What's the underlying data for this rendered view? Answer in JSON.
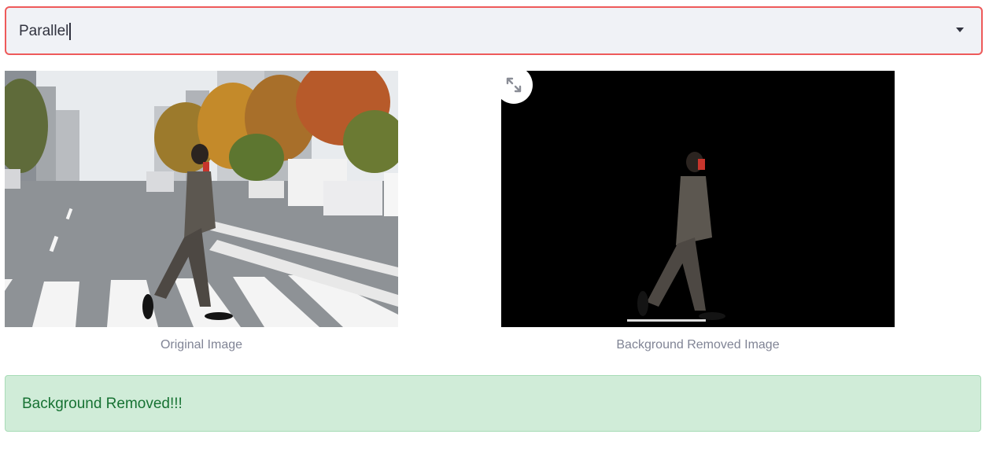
{
  "selectbox": {
    "value": "Parallel"
  },
  "images": {
    "original_caption": "Original Image",
    "removed_caption": "Background Removed Image"
  },
  "alert": {
    "message": "Background Removed!!!"
  },
  "icons": {
    "dropdown": "chevron-down-icon",
    "fullscreen": "expand-icon"
  },
  "colors": {
    "select_border": "#ee5a5a",
    "select_bg": "#f0f2f6",
    "alert_bg": "#d0ecd8",
    "alert_text": "#177233",
    "caption": "#808495"
  }
}
